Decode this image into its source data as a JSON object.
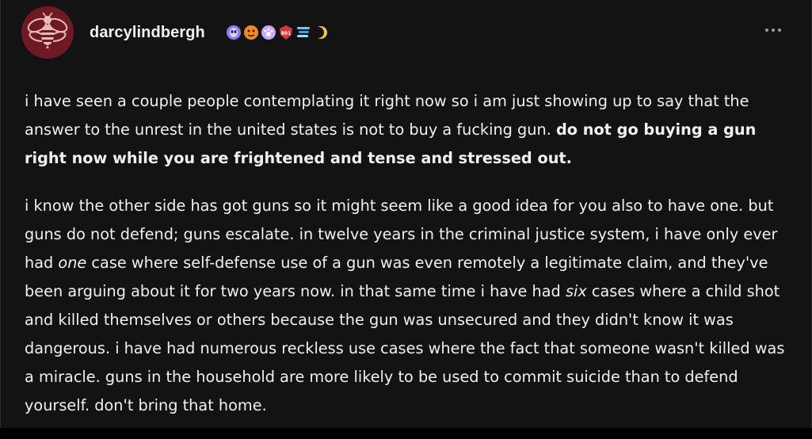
{
  "post": {
    "author": "darcylindbergh",
    "badges": [
      "alien-badge",
      "pumpkin-badge",
      "paw-badge",
      "shield-badge",
      "wave-badge",
      "moon-badge"
    ],
    "paragraph1": {
      "text": "i have seen a couple people contemplating it right now so i am just showing up to say that the answer to the unrest in the united states is not to buy a fucking gun. ",
      "bold": "do not go buying a gun right now while you are frightened and tense and stressed out."
    },
    "paragraph2": {
      "t1": "i know the other side has got guns so it might seem like a good idea for you also to have one. but guns do not defend; guns escalate. in twelve years in the criminal justice system, i have only ever had ",
      "i1": "one",
      "t2": " case where self-defense use of a gun was even remotely a legitimate claim, and they've been arguing about it for two years now. in that same time i have had ",
      "i2": "six",
      "t3": " cases where a child shot and killed themselves or others because the gun was unsecured and they didn't know it was dangerous. i have had numerous reckless use cases where the fact that someone wasn't killed was a miracle. guns in the household are more likely to be used to commit suicide than to defend yourself. don't bring that home."
    }
  },
  "colors": {
    "background": "#131313",
    "text": "#f0f0f0",
    "avatar": "#6e1a23"
  }
}
